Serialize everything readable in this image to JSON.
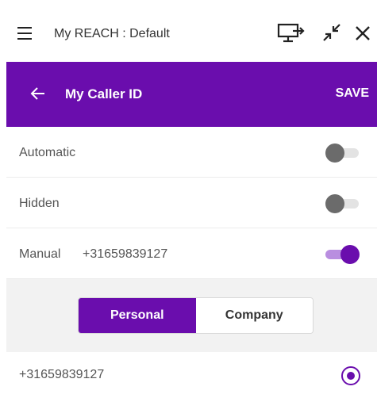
{
  "app": {
    "title": "My REACH : Default"
  },
  "icons": {
    "menu": "hamburger-icon",
    "monitor": "monitor-share-icon",
    "compress": "compress-icon",
    "close": "close-icon",
    "back": "arrow-left-icon"
  },
  "header": {
    "title": "My Caller ID",
    "save_label": "SAVE",
    "color": "#6a0dad"
  },
  "settings": [
    {
      "label": "Automatic",
      "number": "",
      "enabled": false
    },
    {
      "label": "Hidden",
      "number": "",
      "enabled": false
    },
    {
      "label": "Manual",
      "number": "+31659839127",
      "enabled": true
    }
  ],
  "segmented": {
    "options": [
      "Personal",
      "Company"
    ],
    "selected": "Personal"
  },
  "numbers": [
    {
      "value": "+31659839127",
      "selected": true
    }
  ]
}
